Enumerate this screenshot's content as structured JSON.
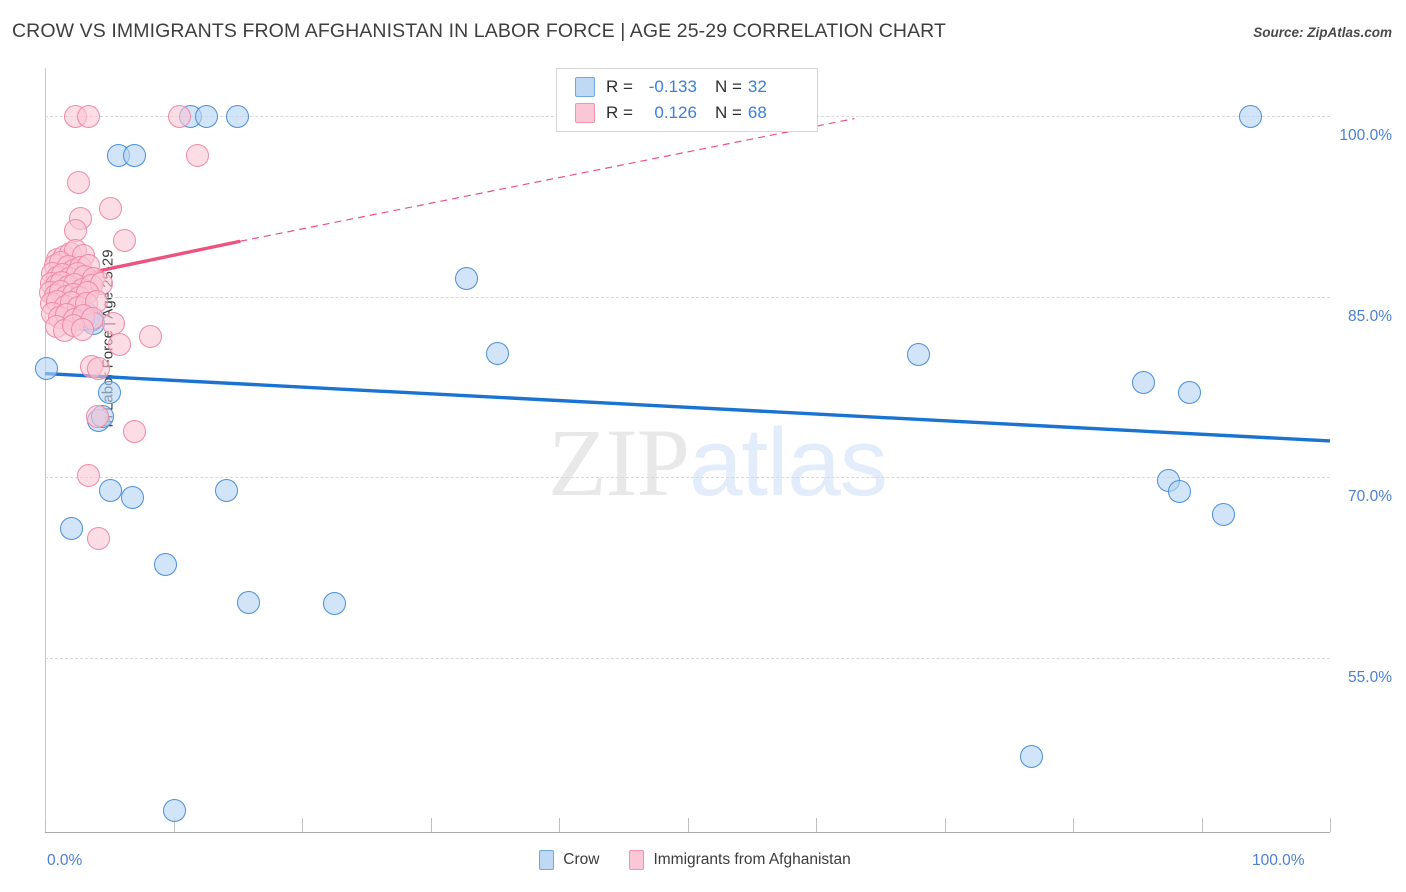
{
  "header": {
    "title": "CROW VS IMMIGRANTS FROM AFGHANISTAN IN LABOR FORCE | AGE 25-29 CORRELATION CHART",
    "source": "Source: ZipAtlas.com"
  },
  "watermark": {
    "part1": "ZIP",
    "part2": "atlas"
  },
  "stats": {
    "rows": [
      {
        "series": "Crow",
        "color": "#bfd9f5",
        "r_label": "R =",
        "r_value": "-0.133",
        "n_label": "N =",
        "n_value": "32"
      },
      {
        "series": "Immigrants from Afghanistan",
        "color": "#fbc6d5",
        "r_label": "R =",
        "r_value": "0.126",
        "n_label": "N =",
        "n_value": "68"
      }
    ]
  },
  "legend": {
    "items": [
      {
        "label": "Crow",
        "color": "#bfd9f5"
      },
      {
        "label": "Immigrants from Afghanistan",
        "color": "#fbc6d5"
      }
    ]
  },
  "chart_data": {
    "type": "scatter",
    "title": "CROW VS IMMIGRANTS FROM AFGHANISTAN IN LABOR FORCE | AGE 25-29 CORRELATION CHART",
    "xlabel": "",
    "ylabel": "In Labor Force | Age 25-29",
    "xlim": [
      0,
      100
    ],
    "ylim": [
      40.5,
      104.0
    ],
    "grid": true,
    "legend_position": "bottom-center",
    "x_ticks": [
      "0.0%",
      "100.0%"
    ],
    "x_tick_values": [
      0,
      100
    ],
    "y_ticks": [
      "100.0%",
      "85.0%",
      "70.0%",
      "55.0%"
    ],
    "y_tick_values": [
      100,
      85,
      70,
      55
    ],
    "series": [
      {
        "name": "Crow",
        "color": "#b5d4f3",
        "edge_color": "#4a90d9",
        "R": -0.133,
        "N": 32,
        "trend": {
          "x0": 0,
          "y0": 78.6,
          "x1": 100,
          "y1": 73.0,
          "style": "solid"
        },
        "points": [
          [
            11.3,
            100.0
          ],
          [
            12.6,
            100.0
          ],
          [
            15.0,
            100.0
          ],
          [
            5.7,
            96.7
          ],
          [
            7.0,
            96.7
          ],
          [
            32.8,
            86.5
          ],
          [
            3.2,
            83.6
          ],
          [
            3.4,
            83.3
          ],
          [
            3.6,
            83.0
          ],
          [
            0.1,
            79.0
          ],
          [
            35.2,
            80.3
          ],
          [
            68.0,
            80.2
          ],
          [
            5.0,
            77.0
          ],
          [
            4.2,
            74.7
          ],
          [
            93.8,
            100.0
          ],
          [
            85.5,
            77.9
          ],
          [
            89.1,
            77.0
          ],
          [
            5.1,
            68.9
          ],
          [
            6.8,
            68.3
          ],
          [
            14.1,
            68.9
          ],
          [
            2.1,
            65.7
          ],
          [
            87.4,
            69.7
          ],
          [
            88.3,
            68.8
          ],
          [
            91.7,
            66.9
          ],
          [
            9.4,
            62.7
          ],
          [
            15.8,
            59.6
          ],
          [
            22.5,
            59.5
          ],
          [
            76.8,
            46.8
          ],
          [
            10.1,
            42.3
          ],
          [
            3.0,
            83.1
          ],
          [
            3.8,
            82.8
          ],
          [
            4.5,
            75.0
          ]
        ]
      },
      {
        "name": "Immigrants from Afghanistan",
        "color": "#fac4d4",
        "edge_color": "#ef8aa8",
        "R": 0.126,
        "N": 68,
        "trend": {
          "x0": 0,
          "y0": 86.2,
          "x1": 15.2,
          "y1": 89.6,
          "style": "solid",
          "dashed_to": {
            "x": 63.0,
            "y": 99.8
          }
        },
        "points": [
          [
            2.4,
            100.0
          ],
          [
            3.4,
            100.0
          ],
          [
            10.5,
            100.0
          ],
          [
            2.6,
            94.5
          ],
          [
            11.9,
            96.7
          ],
          [
            5.1,
            92.3
          ],
          [
            2.8,
            91.5
          ],
          [
            2.4,
            90.5
          ],
          [
            6.2,
            89.7
          ],
          [
            1.0,
            88.1
          ],
          [
            1.5,
            88.3
          ],
          [
            2.0,
            88.6
          ],
          [
            2.4,
            88.8
          ],
          [
            3.0,
            88.4
          ],
          [
            0.8,
            87.6
          ],
          [
            1.2,
            87.8
          ],
          [
            1.8,
            87.5
          ],
          [
            2.2,
            87.2
          ],
          [
            2.8,
            87.4
          ],
          [
            3.4,
            87.6
          ],
          [
            0.6,
            86.9
          ],
          [
            1.0,
            86.6
          ],
          [
            1.4,
            86.8
          ],
          [
            1.9,
            86.5
          ],
          [
            2.5,
            86.9
          ],
          [
            3.1,
            86.7
          ],
          [
            3.8,
            86.5
          ],
          [
            0.5,
            86.1
          ],
          [
            0.9,
            85.9
          ],
          [
            1.3,
            86.2
          ],
          [
            1.8,
            85.8
          ],
          [
            2.3,
            86.0
          ],
          [
            2.9,
            85.6
          ],
          [
            3.6,
            85.9
          ],
          [
            4.4,
            86.1
          ],
          [
            0.4,
            85.3
          ],
          [
            0.8,
            85.1
          ],
          [
            1.2,
            85.4
          ],
          [
            1.7,
            85.0
          ],
          [
            2.2,
            85.2
          ],
          [
            2.7,
            84.9
          ],
          [
            3.3,
            85.3
          ],
          [
            0.5,
            84.4
          ],
          [
            1.0,
            84.6
          ],
          [
            1.6,
            84.2
          ],
          [
            2.1,
            84.5
          ],
          [
            2.6,
            84.1
          ],
          [
            3.2,
            84.4
          ],
          [
            4.0,
            84.6
          ],
          [
            0.6,
            83.6
          ],
          [
            1.1,
            83.3
          ],
          [
            1.7,
            83.5
          ],
          [
            2.3,
            83.1
          ],
          [
            3.0,
            83.4
          ],
          [
            3.7,
            83.2
          ],
          [
            0.9,
            82.5
          ],
          [
            1.5,
            82.2
          ],
          [
            2.2,
            82.6
          ],
          [
            2.9,
            82.3
          ],
          [
            5.3,
            82.8
          ],
          [
            8.2,
            81.7
          ],
          [
            5.8,
            81.0
          ],
          [
            3.6,
            79.2
          ],
          [
            4.2,
            79.0
          ],
          [
            4.1,
            75.0
          ],
          [
            7.0,
            73.8
          ],
          [
            3.4,
            70.1
          ],
          [
            4.2,
            64.9
          ]
        ]
      }
    ]
  }
}
